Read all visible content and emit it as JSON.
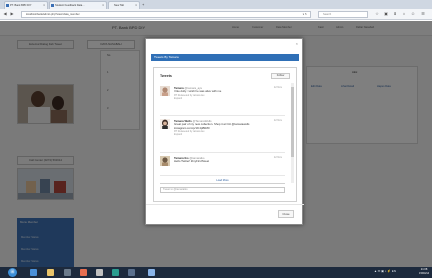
{
  "browser": {
    "tabs": [
      {
        "label": "PT. Bank BPD DIY"
      },
      {
        "label": "Student Feedback Data..."
      },
      {
        "label": "New Tab"
      }
    ],
    "new_tab": "+",
    "url": "localhost/bank/admin.php?view=data_member",
    "search_placeholder": "Search",
    "nav": {
      "back": "◀",
      "forward": "▶",
      "reload": "↻"
    },
    "toolbar_icons": [
      "☆",
      "▣",
      "⬇",
      "⌂",
      "☺",
      "☰"
    ]
  },
  "app": {
    "title": "PT. Bank BPD DIY",
    "menu": [
      "Home",
      "Customer",
      "Data Member",
      "Kasir",
      "Admin",
      "Daftar Nasabah"
    ]
  },
  "sidebar": {
    "top_button": "External Dialog Fab Tweet",
    "second_button": "Call Center (0274) 561614",
    "blue_panel": {
      "heading": "Menu Member",
      "items": [
        "Member Status",
        "Member Status",
        "Member Status"
      ]
    }
  },
  "main": {
    "tab": "DATA NASABAH",
    "table_rows": [
      "1",
      "2",
      "3"
    ],
    "table_header": "No",
    "right_heading": "Aksi",
    "right_actions": [
      "Edit Data",
      "Lihat Detail",
      "Hapus Data"
    ]
  },
  "modal": {
    "close_x": "×",
    "header": "Tweets By Tamara",
    "widget_title": "Tweets",
    "follow_label": "Follow",
    "tweets": [
      {
        "name": "Tamara",
        "handle": "@tamara_ayu",
        "date": "12 Nov",
        "text": "I like dolly. I wish he was alive with me",
        "meta": "RT Retweeted by tamara lau",
        "reply": "Expand"
      },
      {
        "name": "Tamara Wells",
        "handle": "@TamaraWells",
        "date": "12 Nov",
        "text": "Great pair of my new collection. Shop it at Oct @tamarawells instagram.com/p/19:4pBRZ0",
        "meta": "RT Retweeted by tamara lau",
        "reply": "Expand"
      },
      {
        "name": "Tamara Iko",
        "handle": "@tamaraiko",
        "date": "12 Nov",
        "text": "Hello Twitter! #myFirstTweet",
        "meta": "",
        "reply": ""
      }
    ],
    "load_more": "Load More",
    "tweet_to": "Tweet to @tamaraiko",
    "close_button": "Close"
  },
  "taskbar": {
    "start": "⊞",
    "tray": "▲ ✉ ▣ ♪ ⚡ EN",
    "time": "21:08",
    "date": "15/04/14"
  },
  "colors": {
    "accent": "#2f6fb6",
    "overlay": "rgba(0,0,0,0.5)",
    "taskbar": "#1d2a3d"
  }
}
